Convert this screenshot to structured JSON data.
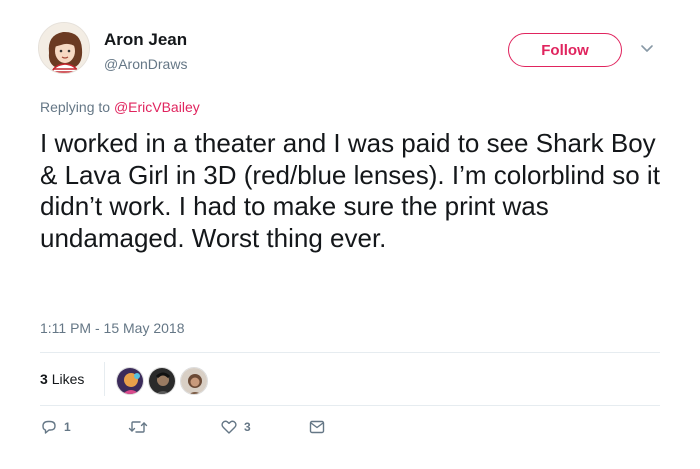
{
  "user": {
    "display_name": "Aron Jean",
    "handle": "@AronDraws",
    "avatar_icon": "profile-avatar-drawing"
  },
  "follow_button": {
    "label": "Follow",
    "color": "#e0245e"
  },
  "menu_caret_icon": "chevron-down-icon",
  "reply": {
    "prefix": "Replying to",
    "mention": "@EricVBailey"
  },
  "tweet": {
    "text": "I worked in a theater and I was paid to see Shark Boy & Lava Girl in 3D (red/blue lenses). I’m colorblind so it didn’t work. I had to make sure the print was undamaged. Worst thing ever.",
    "timestamp": "1:11 PM - 15 May 2018"
  },
  "stats": {
    "likes_count": "3",
    "likes_label": "Likes"
  },
  "actions": {
    "reply_count": "1",
    "retweet_count": "",
    "like_count": "3"
  },
  "colors": {
    "accent": "#e0245e",
    "secondary_text": "#657786",
    "divider": "#e6ecf0"
  }
}
